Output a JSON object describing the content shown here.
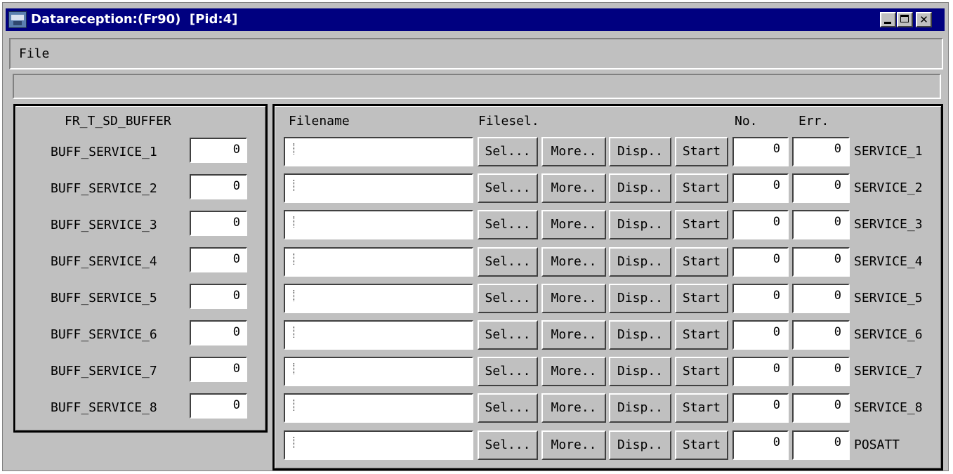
{
  "window": {
    "title": "Datareception:(Fr90)  [Pid:4]"
  },
  "menu": {
    "file": "File"
  },
  "buffer_panel": {
    "title": "FR_T_SD_BUFFER",
    "items": [
      {
        "label": "BUFF_SERVICE_1",
        "value": "0"
      },
      {
        "label": "BUFF_SERVICE_2",
        "value": "0"
      },
      {
        "label": "BUFF_SERVICE_3",
        "value": "0"
      },
      {
        "label": "BUFF_SERVICE_4",
        "value": "0"
      },
      {
        "label": "BUFF_SERVICE_5",
        "value": "0"
      },
      {
        "label": "BUFF_SERVICE_6",
        "value": "0"
      },
      {
        "label": "BUFF_SERVICE_7",
        "value": "0"
      },
      {
        "label": "BUFF_SERVICE_8",
        "value": "0"
      }
    ]
  },
  "file_panel": {
    "headers": {
      "filename": "Filename",
      "filesel": "Filesel.",
      "no": "No.",
      "err": "Err."
    },
    "buttons": {
      "sel": "Sel...",
      "more": "More..",
      "disp": "Disp..",
      "start": "Start"
    },
    "rows": [
      {
        "filename": "",
        "no": "0",
        "err": "0",
        "service": "SERVICE_1"
      },
      {
        "filename": "",
        "no": "0",
        "err": "0",
        "service": "SERVICE_2"
      },
      {
        "filename": "",
        "no": "0",
        "err": "0",
        "service": "SERVICE_3"
      },
      {
        "filename": "",
        "no": "0",
        "err": "0",
        "service": "SERVICE_4"
      },
      {
        "filename": "",
        "no": "0",
        "err": "0",
        "service": "SERVICE_5"
      },
      {
        "filename": "",
        "no": "0",
        "err": "0",
        "service": "SERVICE_6"
      },
      {
        "filename": "",
        "no": "0",
        "err": "0",
        "service": "SERVICE_7"
      },
      {
        "filename": "",
        "no": "0",
        "err": "0",
        "service": "SERVICE_8"
      },
      {
        "filename": "",
        "no": "0",
        "err": "0",
        "service": "POSATT"
      }
    ]
  }
}
